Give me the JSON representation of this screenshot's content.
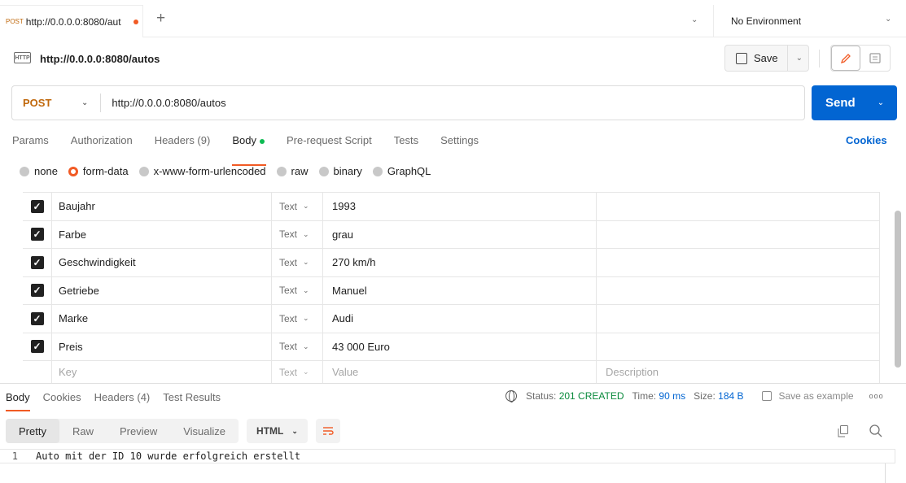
{
  "tab": {
    "method": "POST",
    "url": "http://0.0.0.0:8080/aut"
  },
  "environment": {
    "label": "No Environment"
  },
  "request": {
    "title": "http://0.0.0.0:8080/autos",
    "method": "POST",
    "url": "http://0.0.0.0:8080/autos",
    "save_label": "Save",
    "send_label": "Send",
    "http_badge": "HTTP"
  },
  "request_tabs": [
    "Params",
    "Authorization",
    "Headers (9)",
    "Body",
    "Pre-request Script",
    "Tests",
    "Settings"
  ],
  "cookies_label": "Cookies",
  "body_types": [
    "none",
    "form-data",
    "x-www-form-urlencoded",
    "raw",
    "binary",
    "GraphQL"
  ],
  "selected_body_type": "form-data",
  "form_rows": [
    {
      "key": "Baujahr",
      "type": "Text",
      "value": "1993"
    },
    {
      "key": "Farbe",
      "type": "Text",
      "value": "grau"
    },
    {
      "key": "Geschwindigkeit",
      "type": "Text",
      "value": "270 km/h"
    },
    {
      "key": "Getriebe",
      "type": "Text",
      "value": "Manuel"
    },
    {
      "key": "Marke",
      "type": "Text",
      "value": "Audi"
    },
    {
      "key": "Preis",
      "type": "Text",
      "value": "43 000 Euro"
    }
  ],
  "placeholders": {
    "key": "Key",
    "type": "Text",
    "value": "Value",
    "description": "Description"
  },
  "response_tabs": [
    "Body",
    "Cookies",
    "Headers (4)",
    "Test Results"
  ],
  "response_status": {
    "status_label": "Status:",
    "status": "201 CREATED",
    "time_label": "Time:",
    "time": "90 ms",
    "size_label": "Size:",
    "size": "184 B",
    "save_example": "Save as example"
  },
  "view_modes": [
    "Pretty",
    "Raw",
    "Preview",
    "Visualize"
  ],
  "format": "HTML",
  "response_body": {
    "line": "1",
    "text": "Auto mit der ID 10 wurde erfolgreich erstellt"
  },
  "colors": {
    "accent": "#f15a24",
    "send": "#0265d2",
    "method": "#c0680c",
    "status": "#0a8a3c"
  }
}
